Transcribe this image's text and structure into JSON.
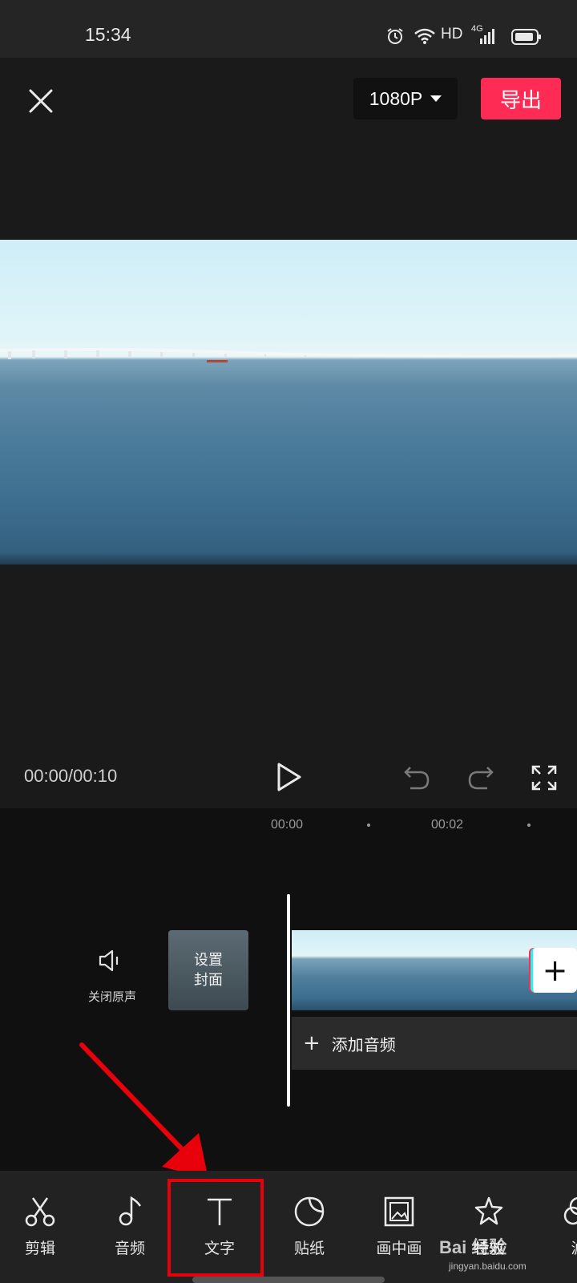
{
  "status_bar": {
    "time": "15:34",
    "hd_label": "HD",
    "network_label": "4G"
  },
  "top_bar": {
    "resolution": "1080P",
    "export_label": "导出"
  },
  "playback": {
    "timecode": "00:00/00:10"
  },
  "timeline": {
    "ticks": [
      "00:00",
      "00:02"
    ],
    "mute_label": "关闭原声",
    "cover_label_line1": "设置",
    "cover_label_line2": "封面",
    "add_audio_label": "添加音频",
    "add_clip_label": "+"
  },
  "toolbar": {
    "items": [
      {
        "label": "剪辑",
        "icon": "scissors-icon"
      },
      {
        "label": "音频",
        "icon": "music-note-icon"
      },
      {
        "label": "文字",
        "icon": "text-icon"
      },
      {
        "label": "贴纸",
        "icon": "sticker-icon"
      },
      {
        "label": "画中画",
        "icon": "picture-in-picture-icon"
      },
      {
        "label": "特效",
        "icon": "effects-star-icon"
      },
      {
        "label": "滤",
        "icon": "filter-icon"
      }
    ]
  },
  "watermark": {
    "text": "Bai 经验",
    "sub": "jingyan.baidu.com"
  },
  "colors": {
    "export_button": "#fe2c55",
    "annotation": "#e8000b",
    "background": "#1a1a1a"
  }
}
